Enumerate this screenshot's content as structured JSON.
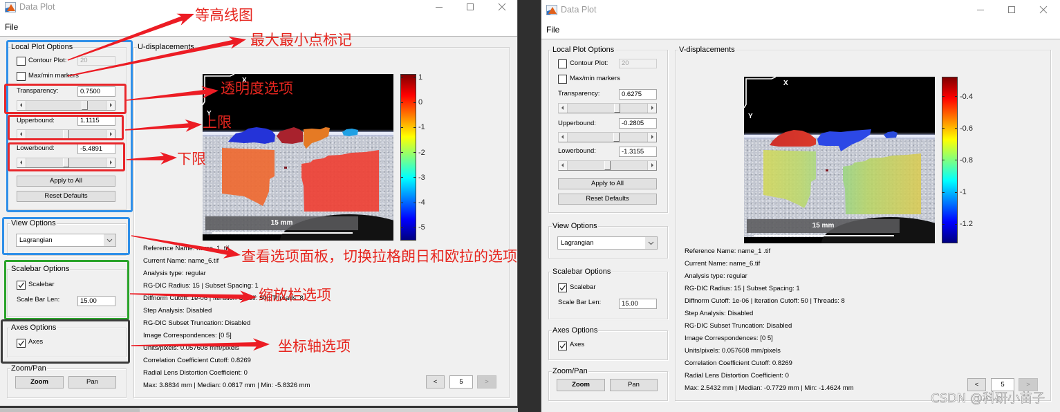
{
  "windows": [
    {
      "title": "Data Plot",
      "menu": [
        "File"
      ],
      "local_plot_options": {
        "title": "Local Plot Options",
        "contour_plot": {
          "label": "Contour Plot:",
          "checked": false,
          "levels": "20",
          "enabled": false
        },
        "max_min_markers": {
          "label": "Max/min markers",
          "checked": false
        },
        "transparency": {
          "label": "Transparency:",
          "value": "0.7500",
          "slider": 0.75
        },
        "upperbound": {
          "label": "Upperbound:",
          "value": "1.1115",
          "slider": 0.5
        },
        "lowerbound": {
          "label": "Lowerbound:",
          "value": "-5.4891",
          "slider": 0.5
        },
        "apply_to_all": "Apply to All",
        "reset_defaults": "Reset Defaults"
      },
      "view_options": {
        "title": "View Options",
        "selected": "Lagrangian"
      },
      "scalebar_options": {
        "title": "Scalebar Options",
        "scalebar_label": "Scalebar",
        "scalebar_checked": true,
        "length_label": "Scale Bar Len:",
        "length_value": "15.00"
      },
      "axes_options": {
        "title": "Axes Options",
        "axes_label": "Axes",
        "axes_checked": true
      },
      "zoom_pan": {
        "title": "Zoom/Pan",
        "zoom": "Zoom",
        "pan": "Pan"
      },
      "plot": {
        "title": "U-displacements",
        "scalebar_text": "15 mm",
        "axis_x": "X",
        "axis_y": "Y",
        "colorbar": {
          "colormap": "jet",
          "max": 1.1115,
          "min": -5.4891,
          "ticks": [
            1,
            0,
            -1,
            -2,
            -3,
            -4,
            -5
          ]
        }
      },
      "info": [
        "Reference Name: name_1 .tif",
        "Current Name: name_6.tif",
        "Analysis type: regular",
        "RG-DIC Radius: 15 | Subset Spacing: 1",
        "Diffnorm Cutoff: 1e-06 | Iteration Cutoff: 50 | Threads: 8",
        "Step Analysis: Disabled",
        "RG-DIC Subset Truncation: Disabled",
        "Image Correspondences: [0 5]",
        "Units/pixels: 0.057608 mm/pixels",
        "Correlation Coefficient Cutoff: 0.8269",
        "Radial Lens Distortion Coefficient: 0",
        "Max: 3.8834 mm | Median: 0.0817 mm | Min: -5.8326 mm"
      ],
      "nav": {
        "prev": "<",
        "frame": "5",
        "next": ">",
        "next_enabled": false
      }
    },
    {
      "title": "Data Plot",
      "menu": [
        "File"
      ],
      "local_plot_options": {
        "title": "Local Plot Options",
        "contour_plot": {
          "label": "Contour Plot:",
          "checked": false,
          "levels": "20",
          "enabled": false
        },
        "max_min_markers": {
          "label": "Max/min markers",
          "checked": false
        },
        "transparency": {
          "label": "Transparency:",
          "value": "0.6275",
          "slider": 0.6275
        },
        "upperbound": {
          "label": "Upperbound:",
          "value": "-0.2805",
          "slider": 0.62
        },
        "lowerbound": {
          "label": "Lowerbound:",
          "value": "-1.3155",
          "slider": 0.5
        },
        "apply_to_all": "Apply to All",
        "reset_defaults": "Reset Defaults"
      },
      "view_options": {
        "title": "View Options",
        "selected": "Lagrangian"
      },
      "scalebar_options": {
        "title": "Scalebar Options",
        "scalebar_label": "Scalebar",
        "scalebar_checked": true,
        "length_label": "Scale Bar Len:",
        "length_value": "15.00"
      },
      "axes_options": {
        "title": "Axes Options",
        "axes_label": "Axes",
        "axes_checked": true
      },
      "zoom_pan": {
        "title": "Zoom/Pan",
        "zoom": "Zoom",
        "pan": "Pan"
      },
      "plot": {
        "title": "V-displacements",
        "scalebar_text": "15 mm",
        "axis_x": "X",
        "axis_y": "Y",
        "colorbar": {
          "colormap": "jet",
          "max": -0.2805,
          "min": -1.3155,
          "ticks": [
            -0.4,
            -0.6,
            -0.8,
            -1,
            -1.2
          ]
        }
      },
      "info": [
        "Reference Name: name_1 .tif",
        "Current Name: name_6.tif",
        "Analysis type: regular",
        "RG-DIC Radius: 15 | Subset Spacing: 1",
        "Diffnorm Cutoff: 1e-06 | Iteration Cutoff: 50 | Threads: 8",
        "Step Analysis: Disabled",
        "RG-DIC Subset Truncation: Disabled",
        "Image Correspondences: [0 5]",
        "Units/pixels: 0.057608 mm/pixels",
        "Correlation Coefficient Cutoff: 0.8269",
        "Radial Lens Distortion Coefficient: 0",
        "Max: 2.5432 mm | Median: -0.7729 mm | Min: -1.4624 mm"
      ],
      "nav": {
        "prev": "<",
        "frame": "5",
        "next": ">",
        "next_enabled": false
      }
    }
  ],
  "annotations": [
    {
      "text": "等高线图",
      "target": "Contour Plot"
    },
    {
      "text": "最大最小点标记",
      "target": "Max/min markers"
    },
    {
      "text": "透明度选项",
      "target": "Transparency"
    },
    {
      "text": "上限",
      "target": "Upperbound"
    },
    {
      "text": "下限",
      "target": "Lowerbound"
    },
    {
      "text": "查看选项面板，切换拉格朗日和欧拉的选项",
      "target": "View Options"
    },
    {
      "text": "缩放栏选项",
      "target": "Scalebar Options"
    },
    {
      "text": "坐标轴选项",
      "target": "Axes Options"
    }
  ],
  "highlight_colors": {
    "blue": "#2f8fe8",
    "red": "#e8262a",
    "green": "#2aa32a",
    "dark": "#3b3b3b",
    "arrow": "#ec1c24"
  },
  "watermark": "CSDN @科研小苗子"
}
